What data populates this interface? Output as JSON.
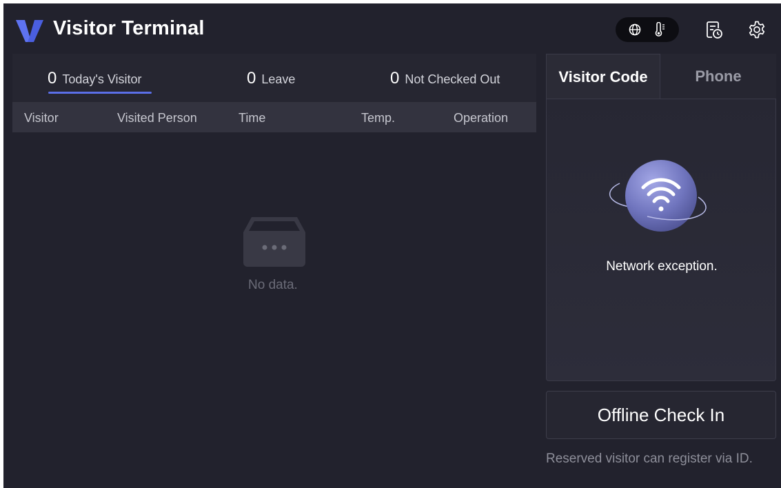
{
  "header": {
    "title": "Visitor Terminal",
    "icons": [
      "logo-v",
      "globe-icon",
      "thermometer-icon",
      "visit-history-icon",
      "gear-icon"
    ]
  },
  "stats": {
    "today": {
      "count": "0",
      "label": "Today's Visitor"
    },
    "leave": {
      "count": "0",
      "label": "Leave"
    },
    "not_checked_out": {
      "count": "0",
      "label": "Not Checked Out"
    },
    "selected": "today"
  },
  "table": {
    "columns": [
      "Visitor",
      "Visited Person",
      "Time",
      "Temp.",
      "Operation"
    ],
    "empty_text": "No data."
  },
  "tabs": {
    "items": [
      "Visitor Code",
      "Phone"
    ],
    "selected": "Visitor Code"
  },
  "code_panel": {
    "message": "Network exception."
  },
  "actions": {
    "offline_check_in": "Offline Check In",
    "reserve_hint": "Reserved visitor can register via ID."
  },
  "colors": {
    "background": "#22222d",
    "accent": "#5b6fe8",
    "logo": "#4a5fe0",
    "sphere": "#7b7fc6"
  }
}
